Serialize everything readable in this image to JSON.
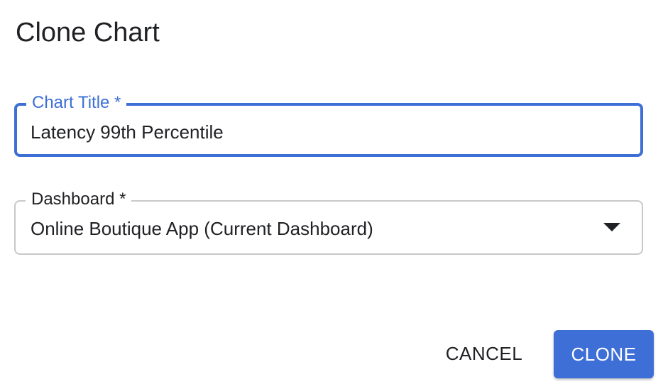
{
  "dialog": {
    "title": "Clone Chart"
  },
  "chart_title_field": {
    "label": "Chart Title *",
    "value": "Latency 99th Percentile",
    "state": "focused"
  },
  "dashboard_field": {
    "label": "Dashboard *",
    "selected": "Online Boutique App (Current Dashboard)",
    "icon": "arrow-drop-down-icon"
  },
  "actions": {
    "cancel_label": "CANCEL",
    "clone_label": "CLONE"
  },
  "colors": {
    "accent": "#3d6fd6",
    "text": "#202124",
    "border": "#c8c8c8"
  }
}
